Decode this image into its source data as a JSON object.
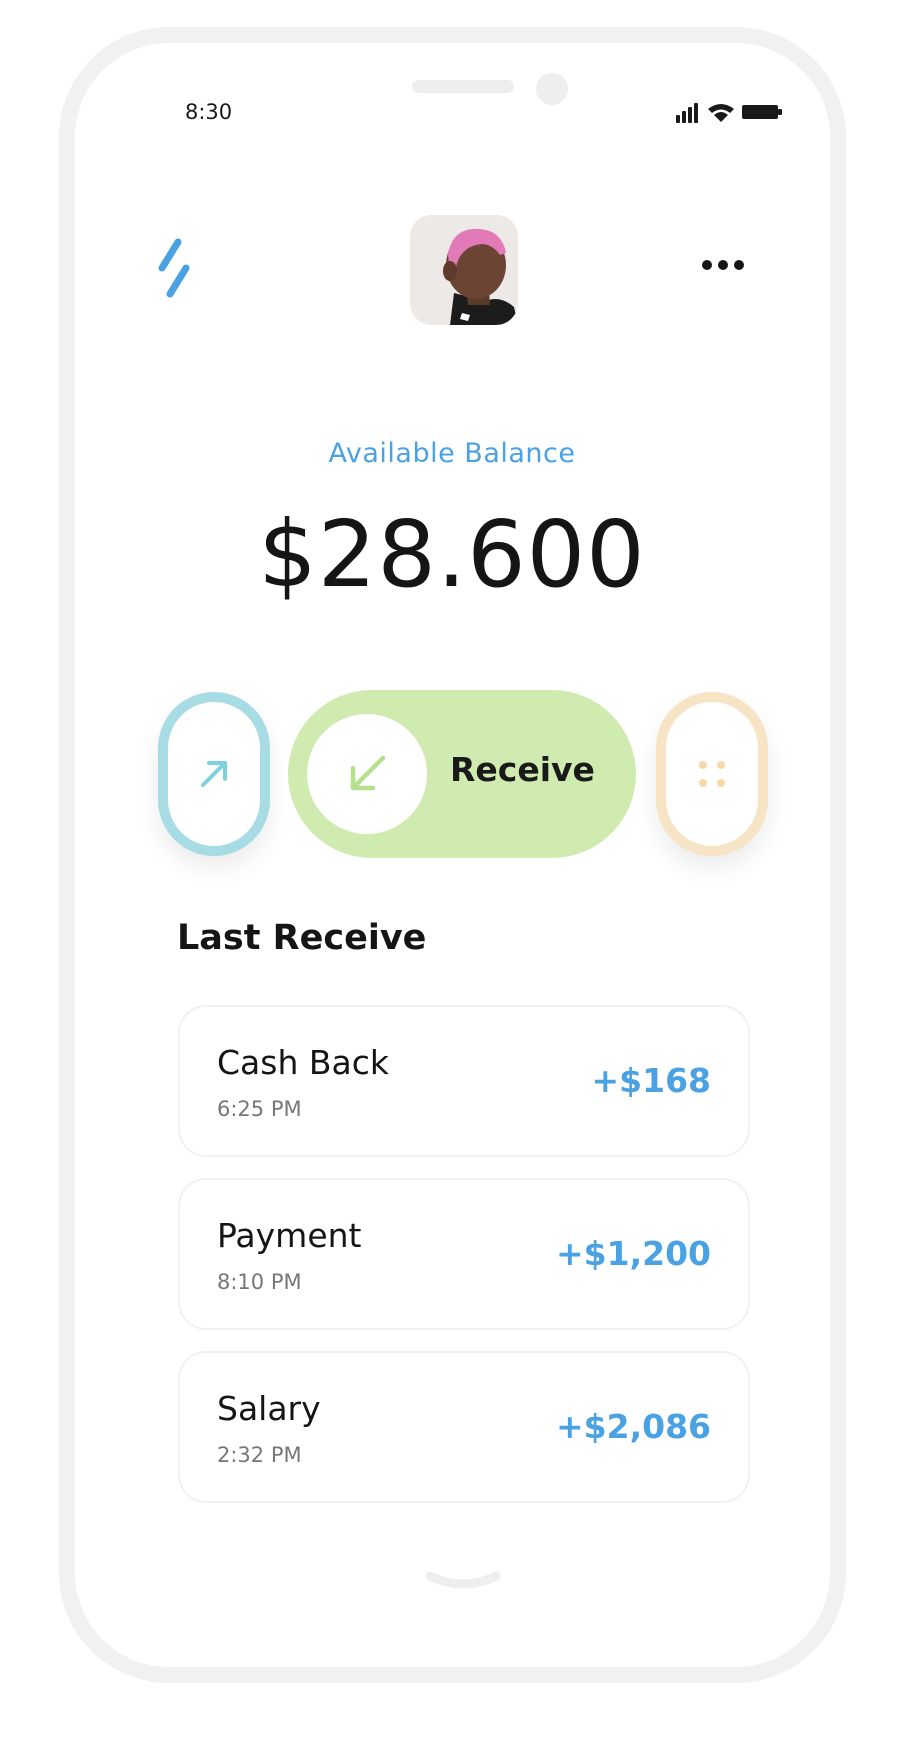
{
  "status_bar": {
    "time": "8:30"
  },
  "header": {
    "menu_icon": "slashes-logo-icon",
    "avatar_alt": "",
    "more_icon": "more-dots-icon"
  },
  "balance": {
    "label": "Available Balance",
    "amount": "$28.600"
  },
  "actions": {
    "send_icon": "arrow-up-right-icon",
    "receive_icon": "arrow-down-left-icon",
    "receive_label": "Receive",
    "more_icon": "grid-dots-icon"
  },
  "section": {
    "title": "Last Receive"
  },
  "transactions": [
    {
      "name": "Cash Back",
      "time": "6:25 PM",
      "amount": "+$168"
    },
    {
      "name": "Payment",
      "time": "8:10 PM",
      "amount": "+$1,200"
    },
    {
      "name": "Salary",
      "time": "2:32 PM",
      "amount": "+$2,086"
    }
  ],
  "colors": {
    "accent_blue": "#4aa2e2",
    "receive_green": "#cfebb0",
    "send_cyan": "#a8dce4",
    "more_peach": "#f7e4c4"
  }
}
